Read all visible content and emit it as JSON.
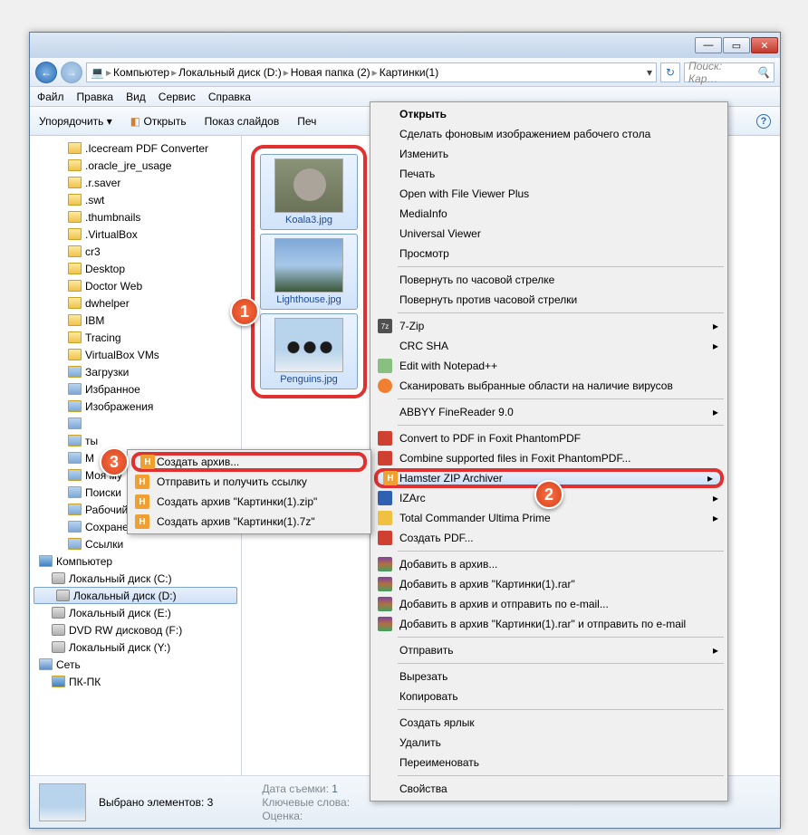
{
  "titlebar": {
    "min": "—",
    "max": "▭",
    "close": "✕"
  },
  "nav": {
    "back": "←",
    "fwd": "→",
    "crumbs": [
      "Компьютер",
      "Локальный диск (D:)",
      "Новая папка (2)",
      "Картинки(1)"
    ],
    "refresh": "↻",
    "search_placeholder": "Поиск: Кар…",
    "search_icon": "🔍"
  },
  "menu": [
    "Файл",
    "Правка",
    "Вид",
    "Сервис",
    "Справка"
  ],
  "toolbar": {
    "organize": "Упорядочить ▾",
    "open": "Открыть",
    "slideshow": "Показ слайдов",
    "print": "Печ",
    "help": "?"
  },
  "tree": [
    {
      "t": ".Icecream PDF Converter",
      "l": 2
    },
    {
      "t": ".oracle_jre_usage",
      "l": 2
    },
    {
      "t": ".r.saver",
      "l": 2
    },
    {
      "t": ".swt",
      "l": 2
    },
    {
      "t": ".thumbnails",
      "l": 2
    },
    {
      "t": ".VirtualBox",
      "l": 2
    },
    {
      "t": "cr3",
      "l": 2
    },
    {
      "t": "Desktop",
      "l": 2
    },
    {
      "t": "Doctor Web",
      "l": 2
    },
    {
      "t": "dwhelper",
      "l": 2
    },
    {
      "t": "IBM",
      "l": 2
    },
    {
      "t": "Tracing",
      "l": 2
    },
    {
      "t": "VirtualBox VMs",
      "l": 2
    },
    {
      "t": "Загрузки",
      "l": 2,
      "sp": 1
    },
    {
      "t": "Избранное",
      "l": 2,
      "sp": 1
    },
    {
      "t": "Изображения",
      "l": 2,
      "sp": 1
    },
    {
      "t": "",
      "l": 2,
      "sp": 1
    },
    {
      "t": "ты",
      "l": 2,
      "sp": 1
    },
    {
      "t": "М",
      "l": 2,
      "sp": 1
    },
    {
      "t": "Моя му",
      "l": 2,
      "sp": 1
    },
    {
      "t": "Поиски",
      "l": 2,
      "sp": 1
    },
    {
      "t": "Рабочий стол",
      "l": 2,
      "sp": 1
    },
    {
      "t": "Сохраненные игры",
      "l": 2,
      "sp": 1
    },
    {
      "t": "Ссылки",
      "l": 2,
      "sp": 1
    },
    {
      "t": "Компьютер",
      "l": 0,
      "ic": "comp"
    },
    {
      "t": "Локальный диск (C:)",
      "l": 1,
      "ic": "disk"
    },
    {
      "t": "Локальный диск (D:)",
      "l": 1,
      "ic": "disk",
      "sel": 1
    },
    {
      "t": "Локальный диск (E:)",
      "l": 1,
      "ic": "disk"
    },
    {
      "t": "DVD RW дисковод (F:)",
      "l": 1,
      "ic": "disk"
    },
    {
      "t": "Локальный диск (Y:)",
      "l": 1,
      "ic": "disk"
    },
    {
      "t": "Сеть",
      "l": 0,
      "ic": "net"
    },
    {
      "t": "ПК-ПК",
      "l": 1,
      "ic": "comp"
    }
  ],
  "thumbs": [
    {
      "cls": "koala",
      "cap": "Koala3.jpg"
    },
    {
      "cls": "light",
      "cap": "Lighthouse.jpg"
    },
    {
      "cls": "peng",
      "cap": "Penguins.jpg"
    }
  ],
  "status": {
    "sel": "Выбрано элементов: 3",
    "date_l": "Дата съемки:",
    "date_v": "1",
    "tags_l": "Ключевые слова:",
    "rate_l": "Оценка:"
  },
  "ctx_main": [
    {
      "t": "Открыть",
      "def": 1
    },
    {
      "t": "Сделать фоновым изображением рабочего стола"
    },
    {
      "t": "Изменить"
    },
    {
      "t": "Печать"
    },
    {
      "t": "Open with File Viewer Plus"
    },
    {
      "t": "MediaInfo"
    },
    {
      "t": "Universal Viewer"
    },
    {
      "t": "Просмотр"
    },
    {
      "sep": 1
    },
    {
      "t": "Повернуть по часовой стрелке"
    },
    {
      "t": "Повернуть против часовой стрелки"
    },
    {
      "sep": 1
    },
    {
      "t": "7-Zip",
      "arr": 1,
      "ico": "7z"
    },
    {
      "t": "CRC SHA",
      "arr": 1
    },
    {
      "t": "Edit with Notepad++",
      "ico": "np"
    },
    {
      "t": "Сканировать выбранные области на наличие вирусов",
      "ico": "av"
    },
    {
      "sep": 1
    },
    {
      "t": "ABBYY FineReader 9.0",
      "arr": 1
    },
    {
      "sep": 1
    },
    {
      "t": "Convert to PDF in Foxit PhantomPDF",
      "ico": "pdf"
    },
    {
      "t": "Combine supported files in Foxit PhantomPDF...",
      "ico": "pdf"
    },
    {
      "t": "Hamster ZIP Archiver",
      "arr": 1,
      "ico": "h",
      "hl": 1,
      "red": 1
    },
    {
      "t": "IZArc",
      "arr": 1,
      "ico": "iz"
    },
    {
      "t": "Total Commander Ultima Prime",
      "arr": 1,
      "ico": "tc"
    },
    {
      "t": "Создать PDF...",
      "ico": "pdf"
    },
    {
      "sep": 1
    },
    {
      "t": "Добавить в архив...",
      "ico": "rar"
    },
    {
      "t": "Добавить в архив \"Картинки(1).rar\"",
      "ico": "rar"
    },
    {
      "t": "Добавить в архив и отправить по e-mail...",
      "ico": "rar"
    },
    {
      "t": "Добавить в архив \"Картинки(1).rar\" и отправить по e-mail",
      "ico": "rar"
    },
    {
      "sep": 1
    },
    {
      "t": "Отправить",
      "arr": 1
    },
    {
      "sep": 1
    },
    {
      "t": "Вырезать"
    },
    {
      "t": "Копировать"
    },
    {
      "sep": 1
    },
    {
      "t": "Создать ярлык"
    },
    {
      "t": "Удалить"
    },
    {
      "t": "Переименовать"
    },
    {
      "sep": 1
    },
    {
      "t": "Свойства"
    }
  ],
  "ctx_sub": [
    {
      "t": "Создать архив...",
      "ico": "h",
      "red": 1
    },
    {
      "t": "Отправить и получить ссылку",
      "ico": "h"
    },
    {
      "t": "Создать архив \"Картинки(1).zip\"",
      "ico": "h"
    },
    {
      "t": "Создать архив \"Картинки(1).7z\"",
      "ico": "h"
    }
  ],
  "callouts": {
    "c1": "1",
    "c2": "2",
    "c3": "3"
  }
}
